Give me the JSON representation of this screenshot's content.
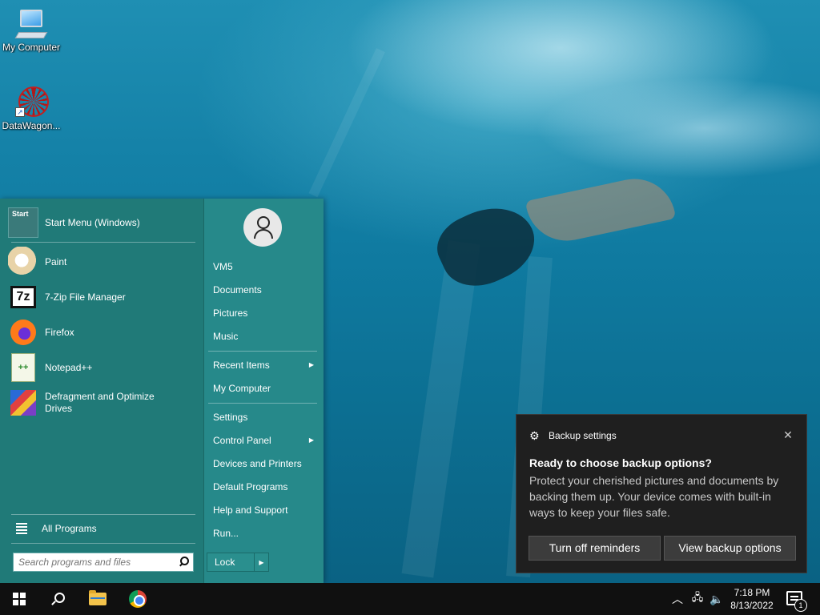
{
  "desktop": {
    "icons": [
      {
        "label": "My Computer"
      },
      {
        "label": "DataWagon..."
      }
    ]
  },
  "start_menu": {
    "pinned_title": "Start Menu (Windows)",
    "programs": [
      {
        "label": "Paint"
      },
      {
        "label": "7-Zip File Manager"
      },
      {
        "label": "Firefox"
      },
      {
        "label": "Notepad++"
      },
      {
        "label": "Defragment and Optimize Drives"
      }
    ],
    "all_programs": "All Programs",
    "search_placeholder": "Search programs and files",
    "right_items": [
      {
        "label": "VM5"
      },
      {
        "label": "Documents"
      },
      {
        "label": "Pictures"
      },
      {
        "label": "Music"
      },
      {
        "label": "Recent Items"
      },
      {
        "label": "My Computer"
      },
      {
        "label": "Settings"
      },
      {
        "label": "Control Panel"
      },
      {
        "label": "Devices and Printers"
      },
      {
        "label": "Default Programs"
      },
      {
        "label": "Help and Support"
      },
      {
        "label": "Run..."
      }
    ],
    "lock_label": "Lock",
    "icon_texts": {
      "start": "Start",
      "sevenzip": "7z"
    }
  },
  "notification": {
    "app_name": "Backup settings",
    "title": "Ready to choose backup options?",
    "body": "Protect your cherished pictures and documents by backing them up. Your device comes with built-in ways to keep your files safe.",
    "buttons": [
      "Turn off reminders",
      "View backup options"
    ]
  },
  "taskbar": {
    "time": "7:18 PM",
    "date": "8/13/2022",
    "notification_count": "1"
  },
  "colors": {
    "start_menu_bg": "#23817f",
    "taskbar_bg": "#101010",
    "toast_bg": "#1f1f1f"
  }
}
